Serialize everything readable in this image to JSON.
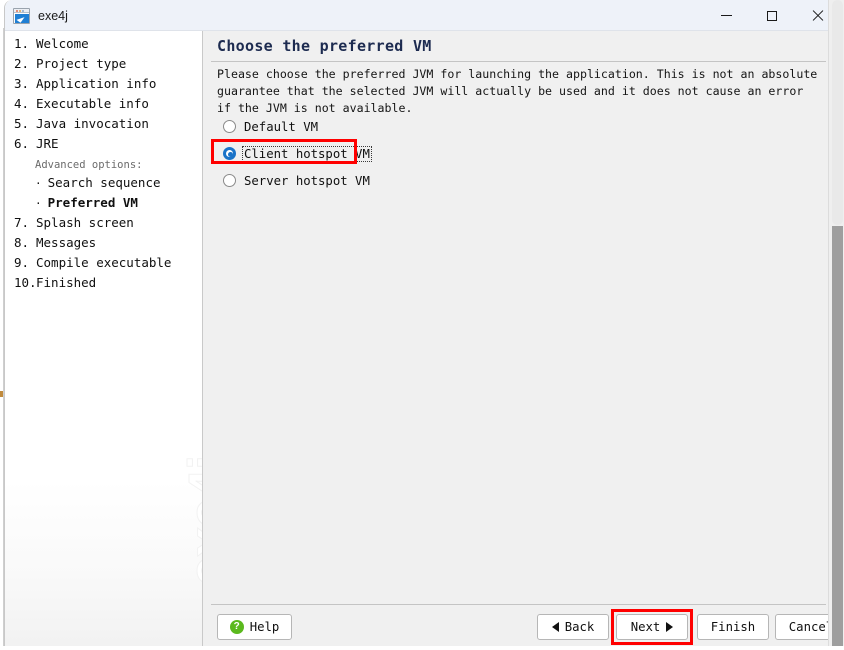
{
  "window": {
    "title": "exe4j",
    "icon": "app-window-icon",
    "controls": {
      "minimize": "minimize-icon",
      "maximize": "maximize-icon",
      "close": "close-icon"
    }
  },
  "sidebar": {
    "watermark": "exe4j",
    "advanced_header": "Advanced options:",
    "steps": [
      {
        "num": "1.",
        "label": "Welcome",
        "current": false
      },
      {
        "num": "2.",
        "label": "Project type",
        "current": false
      },
      {
        "num": "3.",
        "label": "Application info",
        "current": false
      },
      {
        "num": "4.",
        "label": "Executable info",
        "current": false
      },
      {
        "num": "5.",
        "label": "Java invocation",
        "current": false
      },
      {
        "num": "6.",
        "label": "JRE",
        "current": false
      }
    ],
    "substeps": [
      {
        "bullet": "·",
        "label": "Search sequence",
        "current": false
      },
      {
        "bullet": "·",
        "label": "Preferred VM",
        "current": true
      }
    ],
    "steps_after": [
      {
        "num": "7.",
        "label": "Splash screen",
        "current": false
      },
      {
        "num": "8.",
        "label": "Messages",
        "current": false
      },
      {
        "num": "9.",
        "label": "Compile executable",
        "current": false
      },
      {
        "num": "10.",
        "label": "Finished",
        "current": false
      }
    ]
  },
  "content": {
    "title": "Choose the preferred VM",
    "description": "Please choose the preferred JVM for launching the application. This is not an absolute guarantee that the selected JVM will actually be used and it does not cause an error if the JVM is not available.",
    "options": [
      {
        "label": "Default VM",
        "selected": false,
        "focused": false
      },
      {
        "label": "Client hotspot VM",
        "selected": true,
        "focused": true
      },
      {
        "label": "Server hotspot VM",
        "selected": false,
        "focused": false
      }
    ],
    "selected_option": "Client hotspot VM"
  },
  "footer": {
    "help_label": "Help",
    "help_icon": "question-mark-icon",
    "back_label": "Back",
    "back_icon": "triangle-left-icon",
    "next_label": "Next",
    "next_icon": "triangle-right-icon",
    "finish_label": "Finish",
    "cancel_label": "Cancel"
  },
  "annotations": {
    "highlight_color": "#ff0000",
    "highlighted_elements": [
      "Client hotspot VM",
      "Next"
    ]
  },
  "colors": {
    "accent": "#1a73c8",
    "titlebar": "#eef2f9",
    "content_bg": "#f0f0f0",
    "help_green": "#5bb91e",
    "title_text": "#1d2b50"
  }
}
